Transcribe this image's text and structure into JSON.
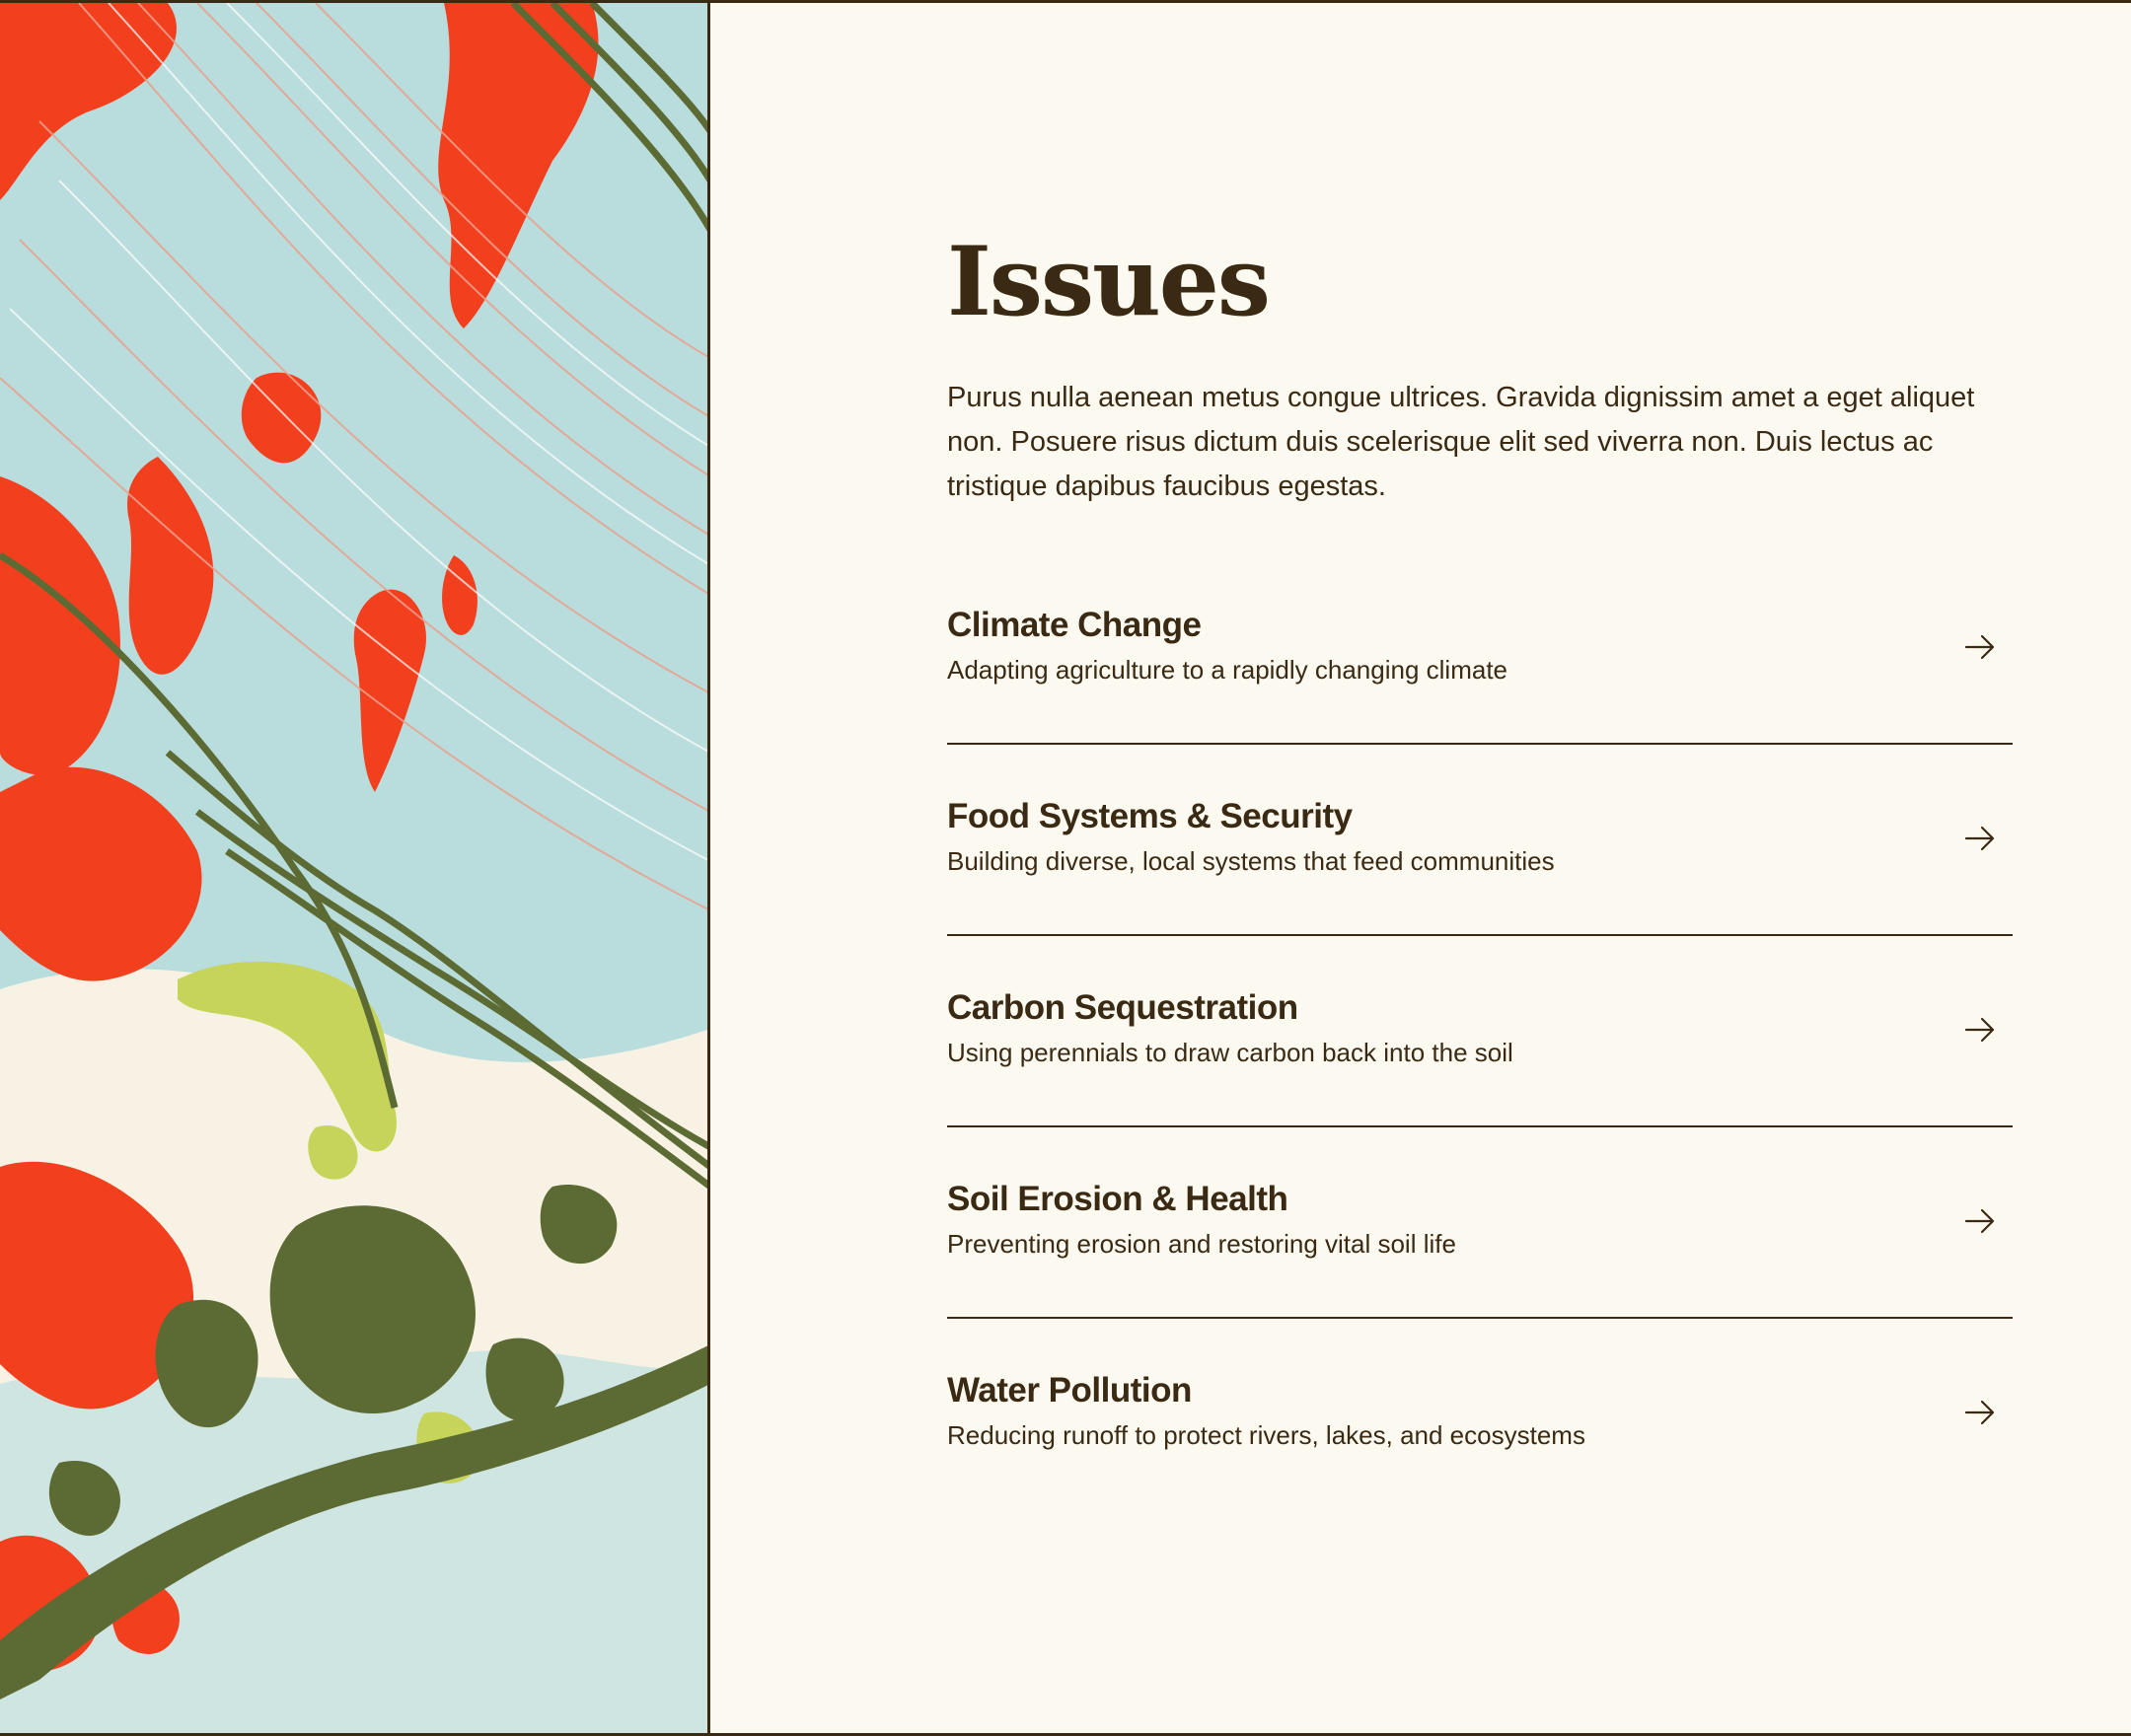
{
  "section": {
    "title": "Issues",
    "intro": "Purus nulla aenean metus congue ultrices. Gravida dignissim amet a eget aliquet non. Posuere risus dictum duis scelerisque elit sed viverra non. Duis lectus ac tristique dapibus faucibus egestas."
  },
  "issues": [
    {
      "title": "Climate Change",
      "subtitle": "Adapting agriculture to a rapidly changing climate",
      "icon": "arrow-right-icon"
    },
    {
      "title": "Food Systems & Security",
      "subtitle": "Building diverse, local systems that feed communities",
      "icon": "arrow-right-icon"
    },
    {
      "title": "Carbon Sequestration",
      "subtitle": "Using perennials to draw carbon back into the soil",
      "icon": "arrow-right-icon"
    },
    {
      "title": "Soil Erosion & Health",
      "subtitle": "Preventing erosion and restoring vital soil life",
      "icon": "arrow-right-icon"
    },
    {
      "title": "Water Pollution",
      "subtitle": "Reducing runoff to protect rivers, lakes, and ecosystems",
      "icon": "arrow-right-icon"
    }
  ],
  "colors": {
    "background": "#fcf9f0",
    "text": "#3a2a14",
    "art_red": "#f2401f",
    "art_blue": "#b9dcdc",
    "art_olive": "#5c6b33",
    "art_lime": "#c6d45a",
    "art_cream": "#f7f2e4"
  }
}
